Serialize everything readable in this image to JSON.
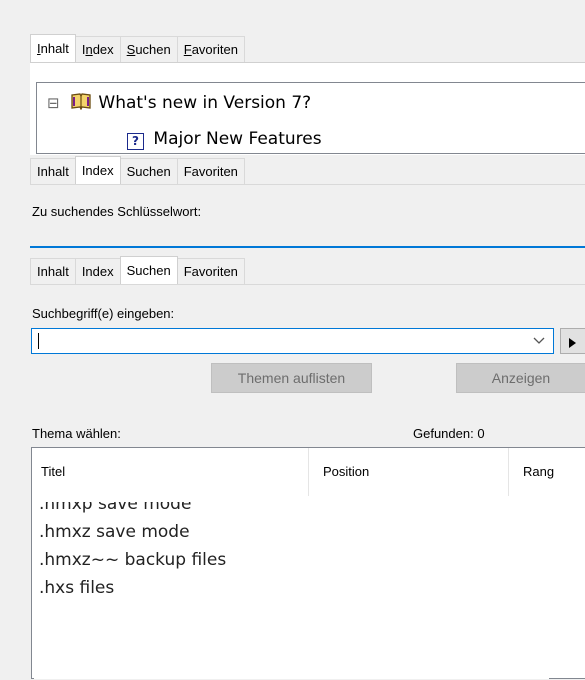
{
  "panel1": {
    "tabs": [
      {
        "prefix": "",
        "accel": "I",
        "rest": "nhalt"
      },
      {
        "prefix": "I",
        "accel": "n",
        "rest": "dex"
      },
      {
        "prefix": "",
        "accel": "S",
        "rest": "uchen"
      },
      {
        "prefix": "",
        "accel": "F",
        "rest": "avoriten"
      }
    ],
    "tree": {
      "root_label": "What's new in Version 7?",
      "child_label": "Major New Features",
      "expander": "⊟"
    }
  },
  "panel2": {
    "tabs": [
      "Inhalt",
      "Index",
      "Suchen",
      "Favoriten"
    ],
    "keyword_label": "Zu suchendes Schlüsselwort:"
  },
  "panel3": {
    "tabs": [
      "Inhalt",
      "Index",
      "Suchen",
      "Favoriten"
    ],
    "search_label": "Suchbegriff(e) eingeben:",
    "search_value": "",
    "list_topics_button": "Themen auflisten",
    "display_button": "Anzeigen",
    "choose_topic_label": "Thema wählen:",
    "found_label": "Gefunden: 0",
    "columns": [
      "Titel",
      "Position",
      "Rang"
    ],
    "results_list": [
      ".hmxp save mode",
      ".hmxz save mode",
      ".hmxz~~ backup files",
      ".hxs files"
    ]
  }
}
